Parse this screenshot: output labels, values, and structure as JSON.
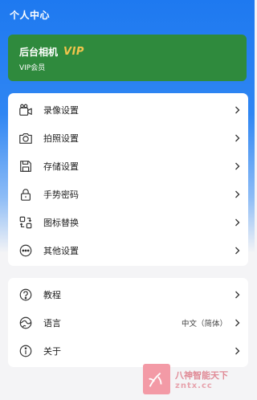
{
  "header": {
    "title": "个人中心"
  },
  "vip": {
    "app_name": "后台相机",
    "badge": "VIP",
    "subtitle": "VIP会员"
  },
  "menu_group_1": [
    {
      "label": "录像设置",
      "icon": "video-camera-icon"
    },
    {
      "label": "拍照设置",
      "icon": "camera-icon"
    },
    {
      "label": "存储设置",
      "icon": "save-icon"
    },
    {
      "label": "手势密码",
      "icon": "lock-icon"
    },
    {
      "label": "图标替换",
      "icon": "swap-icon"
    },
    {
      "label": "其他设置",
      "icon": "more-icon"
    }
  ],
  "menu_group_2": [
    {
      "label": "教程",
      "icon": "help-icon",
      "value": ""
    },
    {
      "label": "语言",
      "icon": "language-icon",
      "value": "中文（简体）"
    },
    {
      "label": "关于",
      "icon": "info-icon",
      "value": ""
    }
  ],
  "watermark": {
    "line1": "八神智能天下",
    "line2": "zntx.cc"
  },
  "colors": {
    "header_blue": "#1e79f0",
    "vip_green": "#2f8a3d",
    "vip_gold": "#f2c44c"
  }
}
